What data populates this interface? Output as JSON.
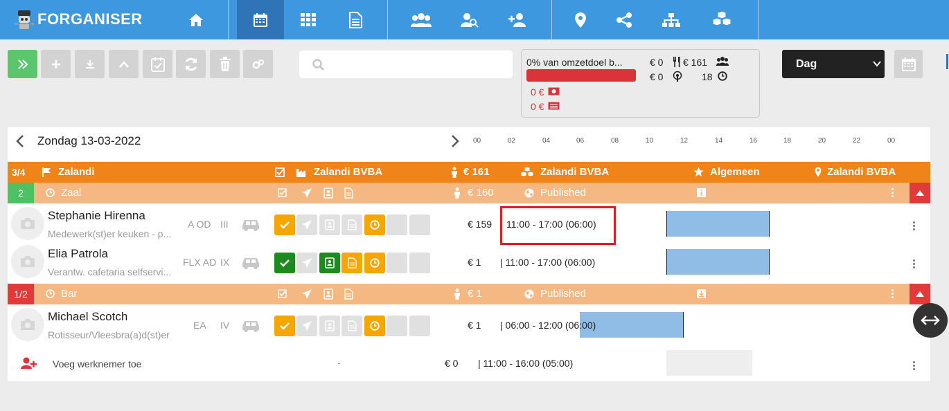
{
  "app": {
    "name": "FORGANISER"
  },
  "search": {
    "placeholder": ""
  },
  "summary": {
    "title": "0% van omzetdoel b...",
    "progress_percent": 0,
    "val_a": "€ 0",
    "val_b": "€ 161",
    "val_c": "€ 0",
    "val_d": "18",
    "red_a": "0 €",
    "red_b": "0 €"
  },
  "view_select": {
    "value": "Dag"
  },
  "date": {
    "label": "Zondag 13-03-2022"
  },
  "hours": [
    "00",
    "02",
    "04",
    "06",
    "08",
    "10",
    "12",
    "14",
    "16",
    "18",
    "20",
    "22",
    "00"
  ],
  "header": {
    "badge": "3/4",
    "name": "Zalandi",
    "company": "Zalandi BVBA",
    "cost": "€ 161",
    "company2": "Zalandi BVBA",
    "category": "Algemeen",
    "location": "Zalandi BVBA"
  },
  "groups": [
    {
      "badge": "2",
      "badge_color": "#4cc265",
      "name": "Zaal",
      "cost": "€ 160",
      "status": "Published"
    },
    {
      "badge": "1/2",
      "badge_color": "#e03a3a",
      "name": "Bar",
      "cost": "€ 1",
      "status": "Published"
    }
  ],
  "employees": [
    {
      "name": "Stephanie Hirenna",
      "role": "Medewerk(st)er keuken - p...",
      "code": "A OD",
      "level": "III",
      "cost": "€ 159",
      "shift": "11:00 - 17:00 (06:00)",
      "shift_start": 11,
      "shift_end": 17
    },
    {
      "name": "Elia Patrola",
      "role": "Verantw. cafetaria selfservi...",
      "code": "FLX AD",
      "level": "IX",
      "cost": "€ 1",
      "shift": "| 11:00 - 17:00 (06:00)",
      "shift_start": 11,
      "shift_end": 17
    },
    {
      "name": "Michael Scotch",
      "role": "Rotisseur/Vleesbra(a)d(st)er",
      "code": "EA",
      "level": "IV",
      "cost": "€ 1",
      "shift": "| 06:00 - 12:00 (06:00)",
      "shift_start": 6,
      "shift_end": 12
    }
  ],
  "add_employee": {
    "label": "Voeg werknemer toe",
    "dash": "-",
    "cost": "€ 0",
    "shift": "| 11:00 - 16:00 (05:00)"
  }
}
